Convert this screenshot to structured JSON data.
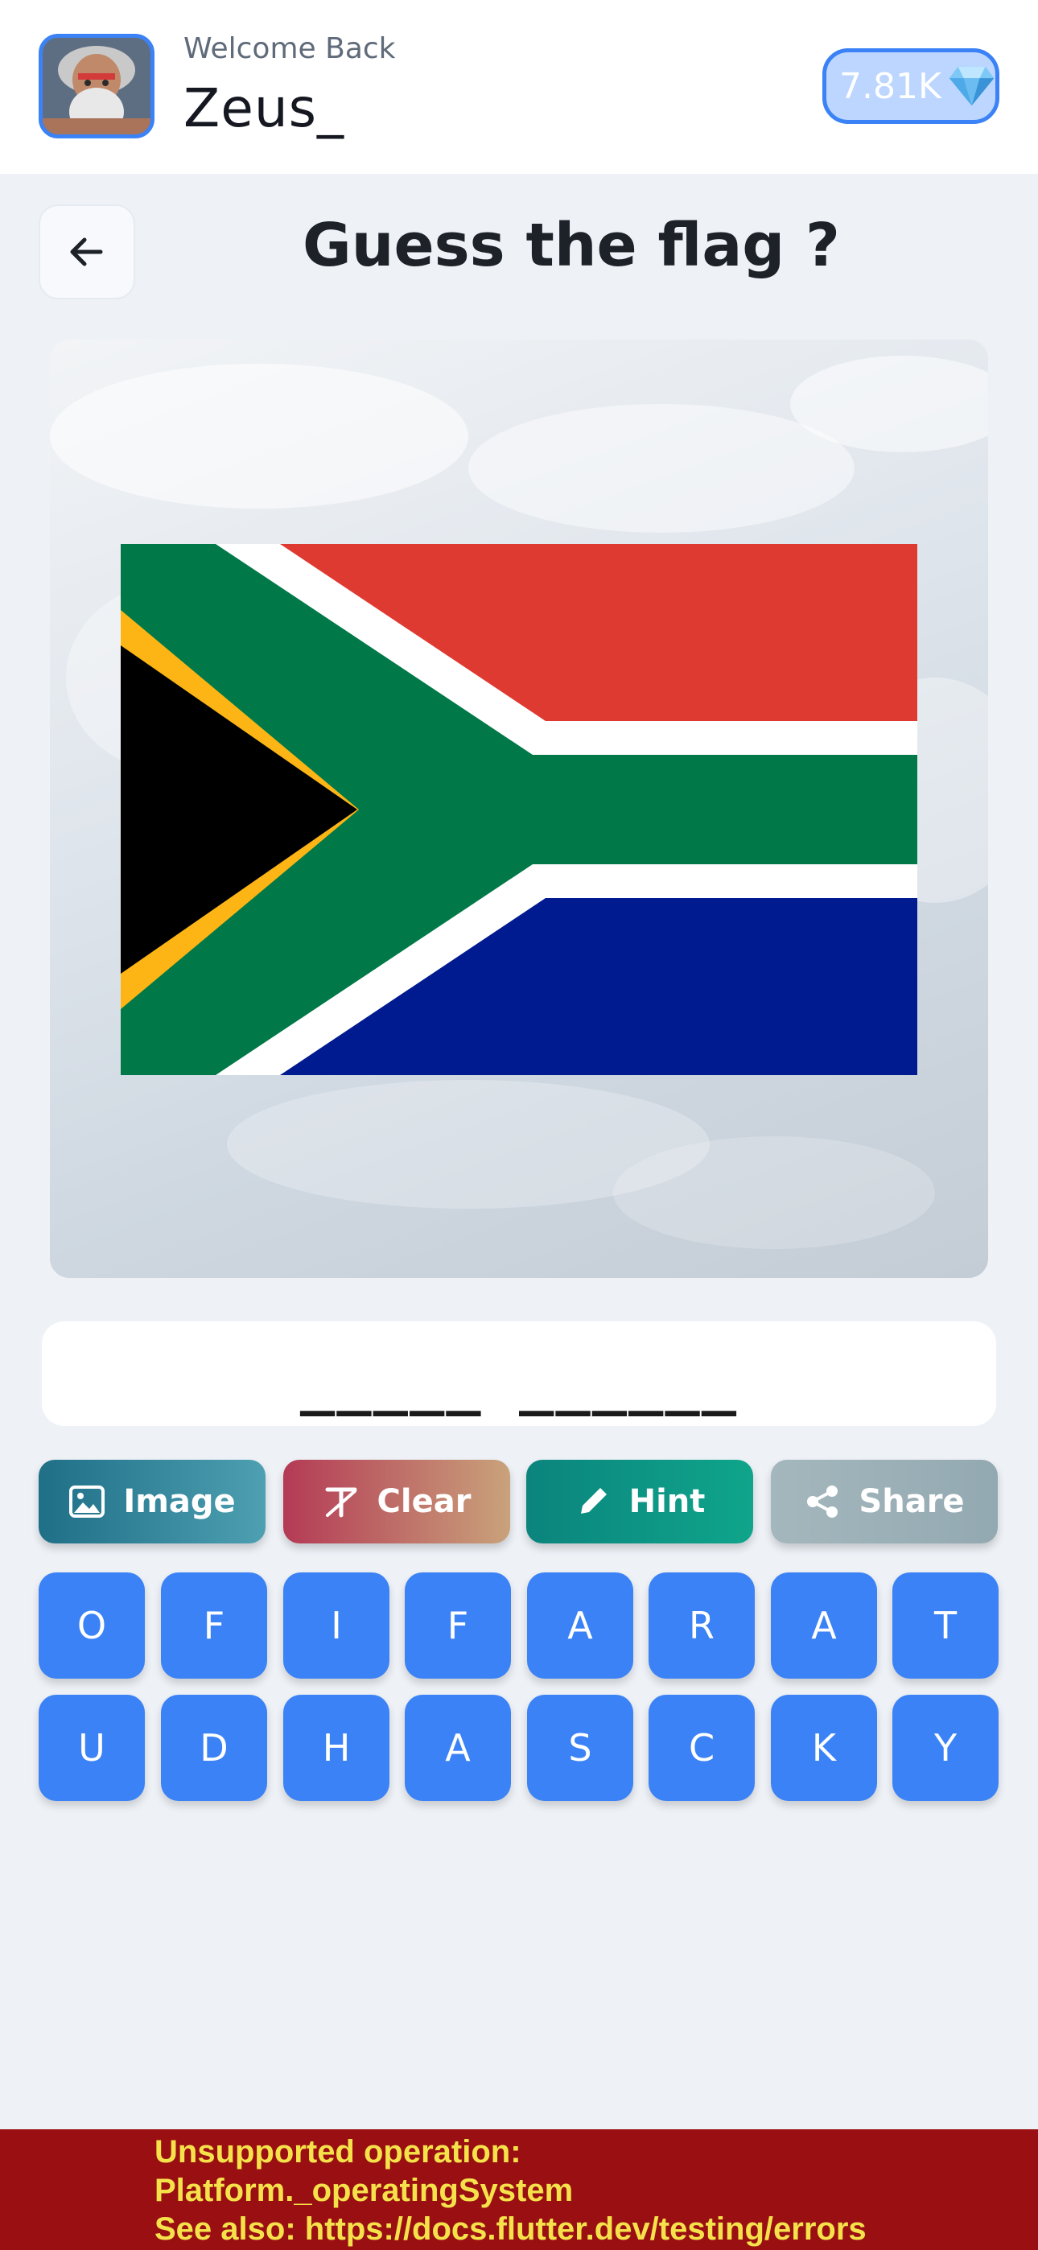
{
  "header": {
    "welcome": "Welcome Back",
    "username": "Zeus_",
    "gems": "7.81K",
    "gem_icon": "diamond-icon",
    "avatar_icon": "zeus-avatar"
  },
  "title": "Guess the flag ?",
  "flag": {
    "colors": {
      "red": "#de3a31",
      "blue": "#001a8f",
      "green": "#007848",
      "black": "#000000",
      "yellow": "#fdb515",
      "white": "#ffffff"
    }
  },
  "answer": "_____ ______",
  "actions": [
    {
      "label": "Image",
      "icon": "image-icon"
    },
    {
      "label": "Clear",
      "icon": "clear-format-icon"
    },
    {
      "label": "Hint",
      "icon": "pencil-icon"
    },
    {
      "label": "Share",
      "icon": "share-icon"
    }
  ],
  "keys": [
    [
      "O",
      "F",
      "I",
      "F",
      "A",
      "R",
      "A",
      "T"
    ],
    [
      "U",
      "D",
      "H",
      "A",
      "S",
      "C",
      "K",
      "Y"
    ]
  ],
  "error": {
    "line1": "Unsupported operation:",
    "line2": "Platform._operatingSystem",
    "line3": "See also: https://docs.flutter.dev/testing/errors"
  }
}
